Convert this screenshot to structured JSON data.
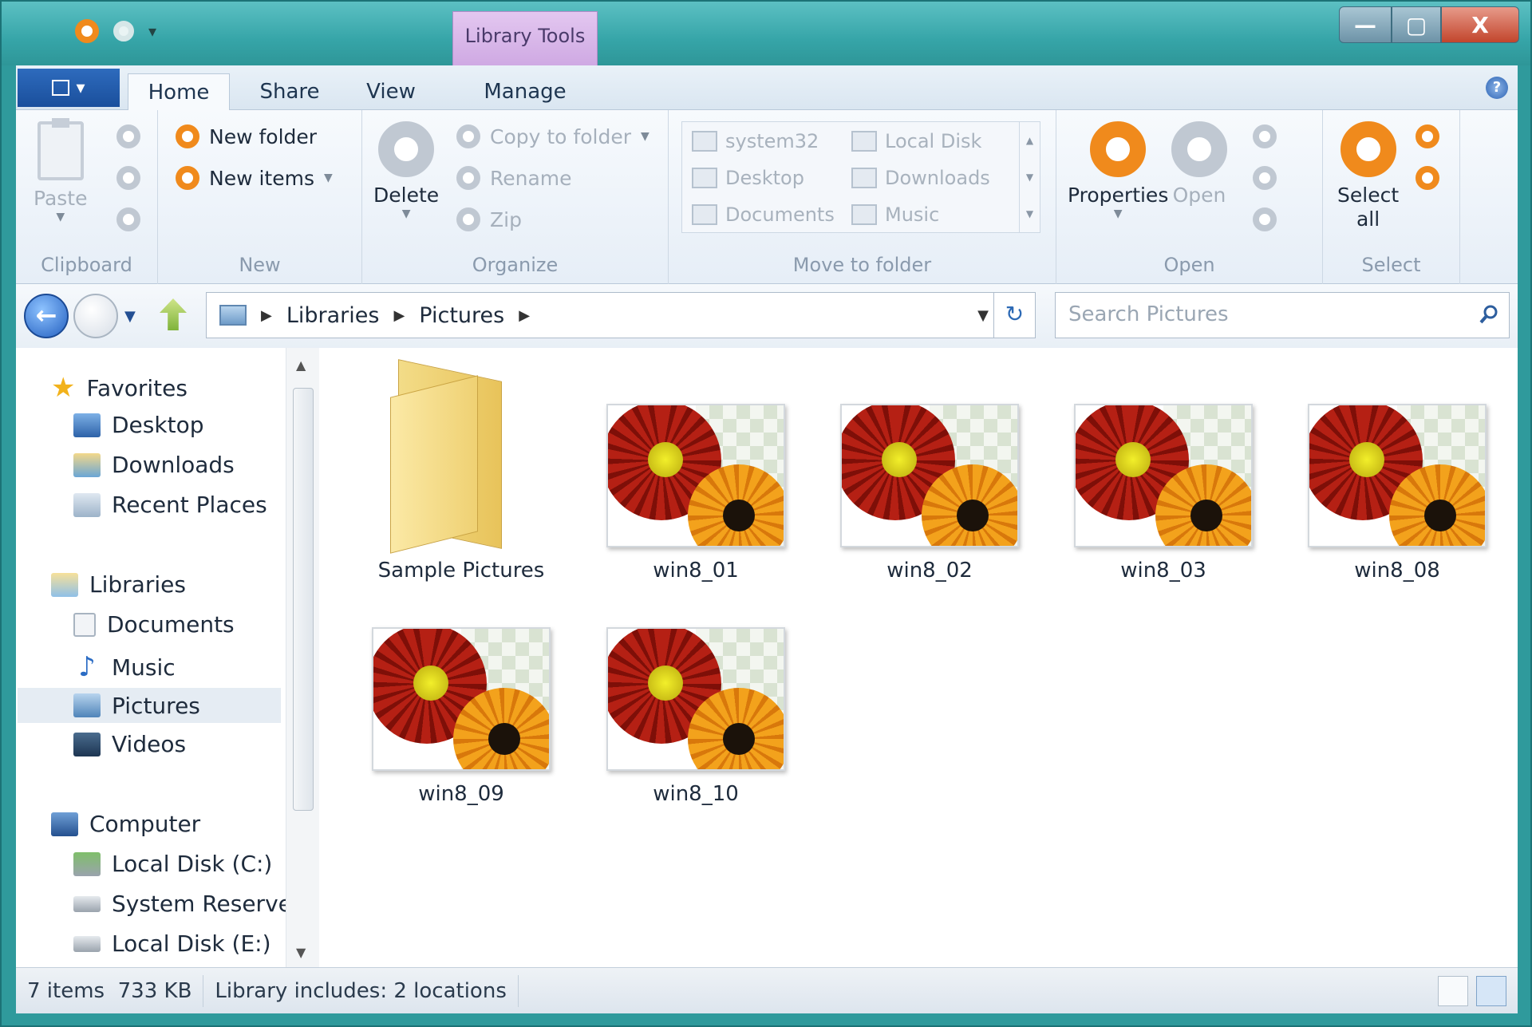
{
  "window": {
    "context_tab": "Library Tools",
    "minimize_glyph": "—",
    "maximize_glyph": "▢",
    "close_glyph": "X"
  },
  "ribbon_tabs": {
    "file_glyph": "▾",
    "home": "Home",
    "share": "Share",
    "view": "View",
    "manage": "Manage",
    "help_glyph": "?"
  },
  "ribbon": {
    "clipboard": {
      "paste": "Paste",
      "label": "Clipboard"
    },
    "new": {
      "new_folder": "New folder",
      "new_items": "New items",
      "label": "New"
    },
    "organize": {
      "delete": "Delete",
      "copy_to_folder": "Copy to folder",
      "rename": "Rename",
      "zip": "Zip",
      "label": "Organize"
    },
    "move_to_folder": {
      "items": [
        "system32",
        "Local Disk",
        "Desktop",
        "Downloads",
        "Documents",
        "Music"
      ],
      "label": "Move to folder"
    },
    "open": {
      "properties": "Properties",
      "open": "Open",
      "label": "Open"
    },
    "select": {
      "select_all_line1": "Select",
      "select_all_line2": "all",
      "label": "Select"
    }
  },
  "address_bar": {
    "crumbs": [
      "Libraries",
      "Pictures"
    ],
    "search_placeholder": "Search Pictures"
  },
  "nav_pane": {
    "favorites": {
      "label": "Favorites",
      "items": [
        "Desktop",
        "Downloads",
        "Recent Places"
      ]
    },
    "libraries": {
      "label": "Libraries",
      "items": [
        "Documents",
        "Music",
        "Pictures",
        "Videos"
      ]
    },
    "computer": {
      "label": "Computer",
      "items": [
        "Local Disk (C:)",
        "System Reserved",
        "Local Disk (E:)"
      ]
    },
    "selected": "Pictures"
  },
  "files": [
    {
      "name": "Sample Pictures",
      "kind": "folder"
    },
    {
      "name": "win8_01",
      "kind": "image"
    },
    {
      "name": "win8_02",
      "kind": "image"
    },
    {
      "name": "win8_03",
      "kind": "image"
    },
    {
      "name": "win8_08",
      "kind": "image"
    },
    {
      "name": "win8_09",
      "kind": "image"
    },
    {
      "name": "win8_10",
      "kind": "image"
    }
  ],
  "status_bar": {
    "item_count": "7 items",
    "size": "733 KB",
    "library_info": "Library includes: 2 locations"
  },
  "colors": {
    "frame": "#2f9a9c",
    "accent_orange": "#f08a1c",
    "file_tab": "#1a4f9c",
    "context_tab": "#cfa9e3"
  }
}
